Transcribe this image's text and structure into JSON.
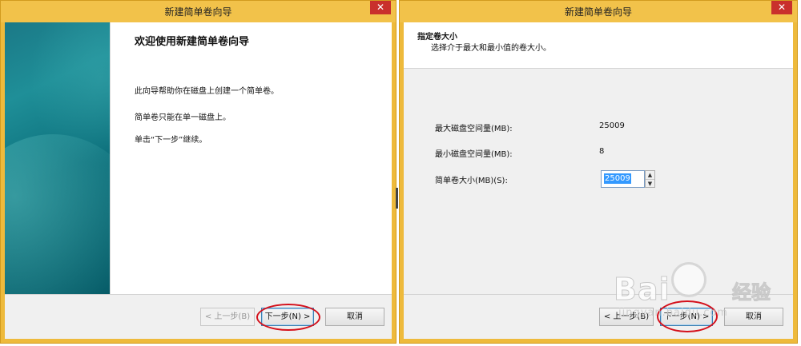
{
  "left_window": {
    "title": "新建简单卷向导",
    "close_glyph": "✕",
    "welcome_title": "欢迎使用新建简单卷向导",
    "paragraphs": [
      "此向导帮助你在磁盘上创建一个简单卷。",
      "简单卷只能在单一磁盘上。",
      "单击“下一步”继续。"
    ],
    "buttons": {
      "back": "< 上一步(B)",
      "next": "下一步(N) >",
      "cancel": "取消"
    }
  },
  "right_window": {
    "title": "新建简单卷向导",
    "close_glyph": "✕",
    "header_title": "指定卷大小",
    "header_subtitle": "选择介于最大和最小值的卷大小。",
    "fields": {
      "max_label": "最大磁盘空间量(MB):",
      "max_value": "25009",
      "min_label": "最小磁盘空间量(MB):",
      "min_value": "8",
      "size_label": "简单卷大小(MB)(S):",
      "size_value": "25009"
    },
    "spin_up": "▲",
    "spin_down": "▼",
    "buttons": {
      "back": "< 上一步(B)",
      "next": "下一步(N) >",
      "cancel": "取消"
    }
  },
  "watermark": {
    "brand": "Bai",
    "brand_cn": "经验",
    "sub": "jingyan.baidu.com"
  },
  "colors": {
    "title_bar": "#f2c24a",
    "frame": "#eeba3c",
    "close": "#c9302c",
    "highlight_circle": "#d4101b",
    "selection": "#3399ff"
  }
}
